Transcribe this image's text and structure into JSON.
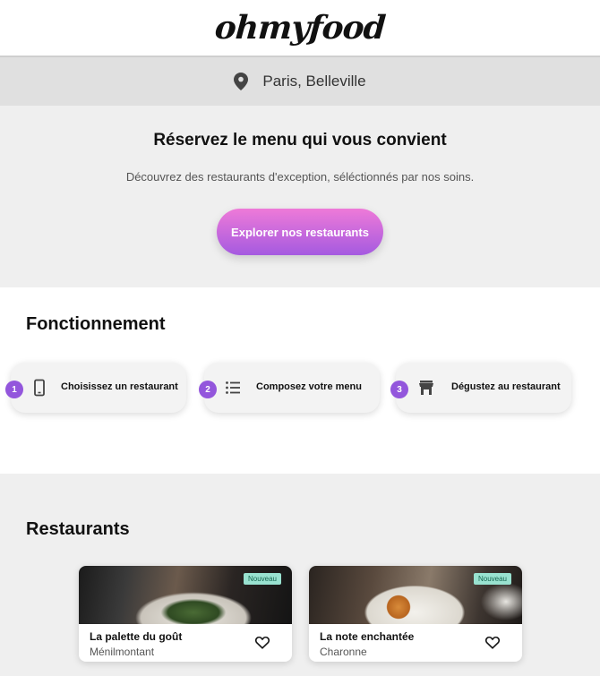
{
  "header": {
    "logo": "ohmyfood"
  },
  "location": {
    "text": "Paris, Belleville",
    "icon": "map-pin-icon"
  },
  "hero": {
    "title": "Réservez le menu qui vous convient",
    "subtitle": "Découvrez des restaurants d'exception, séléctionnés par nos soins.",
    "button_label": "Explorer nos restaurants"
  },
  "how": {
    "title": "Fonctionnement",
    "steps": [
      {
        "number": "1",
        "label": "Choisissez un restaurant",
        "icon": "smartphone-icon"
      },
      {
        "number": "2",
        "label": "Composez votre menu",
        "icon": "list-icon"
      },
      {
        "number": "3",
        "label": "Dégustez au restaurant",
        "icon": "store-icon"
      }
    ]
  },
  "restaurants": {
    "title": "Restaurants",
    "items": [
      {
        "name": "La palette du goût",
        "area": "Ménilmontant",
        "badge": "Nouveau"
      },
      {
        "name": "La note enchantée",
        "area": "Charonne",
        "badge": "Nouveau"
      }
    ]
  },
  "colors": {
    "accent_pink": "#ee7ad8",
    "accent_purple": "#9356dc",
    "badge_bg": "#99e2d0"
  }
}
